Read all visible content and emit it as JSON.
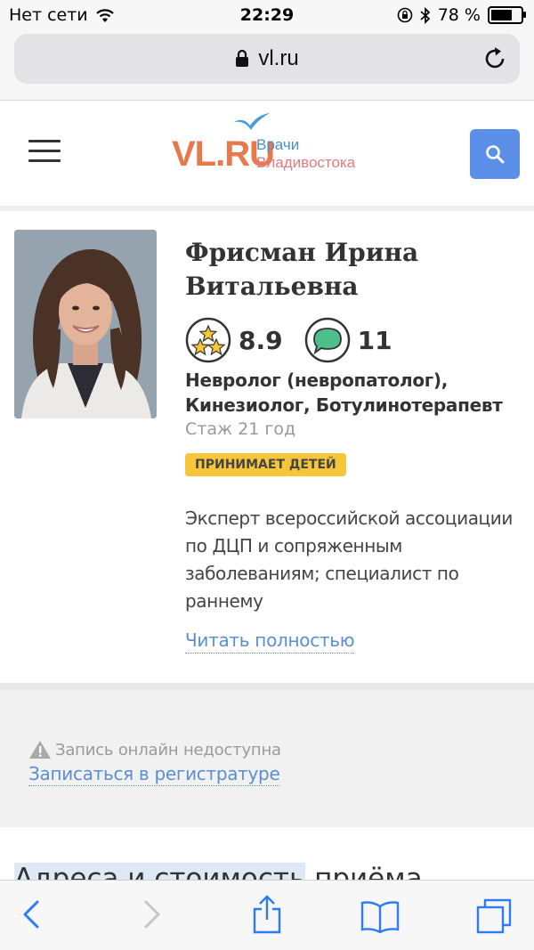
{
  "status_bar": {
    "carrier": "Нет сети",
    "time": "22:29",
    "battery": "78 %",
    "battery_level": 0.78
  },
  "browser": {
    "url": "vl.ru"
  },
  "site_header": {
    "logo_main": "VL.RU",
    "logo_line1": "Врачи",
    "logo_line2": "Владивостока",
    "colors": {
      "logo_orange": "#e8794a",
      "logo_blue": "#4a8fc5",
      "logo_red": "#e27c7c",
      "search_blue": "#5b8fe8"
    }
  },
  "doctor": {
    "name": "Фрисман Ирина Витальевна",
    "rating": "8.9",
    "reviews": "11",
    "specialty": "Невролог (невропатолог), Кинезиолог, Ботулинотерапевт",
    "experience": "Стаж 21 год",
    "badge": "ПРИНИМАЕТ ДЕТЕЙ",
    "bio": "Эксперт всероссийской ассоциации по ДЦП и сопряженным заболеваниям; специалист по раннему",
    "read_more": "Читать полностью"
  },
  "appointment": {
    "note": "Запись онлайн недоступна",
    "link": "Записаться в регистратуре"
  },
  "addresses": {
    "heading_highlight": "Адреса и стоимость",
    "heading_rest": " приёма"
  },
  "icons": [
    "wifi-icon",
    "lock-icon",
    "reload-icon",
    "hamburger-icon",
    "search-icon",
    "stars-rating-icon",
    "speech-bubble-icon",
    "warning-icon",
    "back-icon",
    "forward-icon",
    "share-icon",
    "bookmarks-icon",
    "tabs-icon"
  ]
}
